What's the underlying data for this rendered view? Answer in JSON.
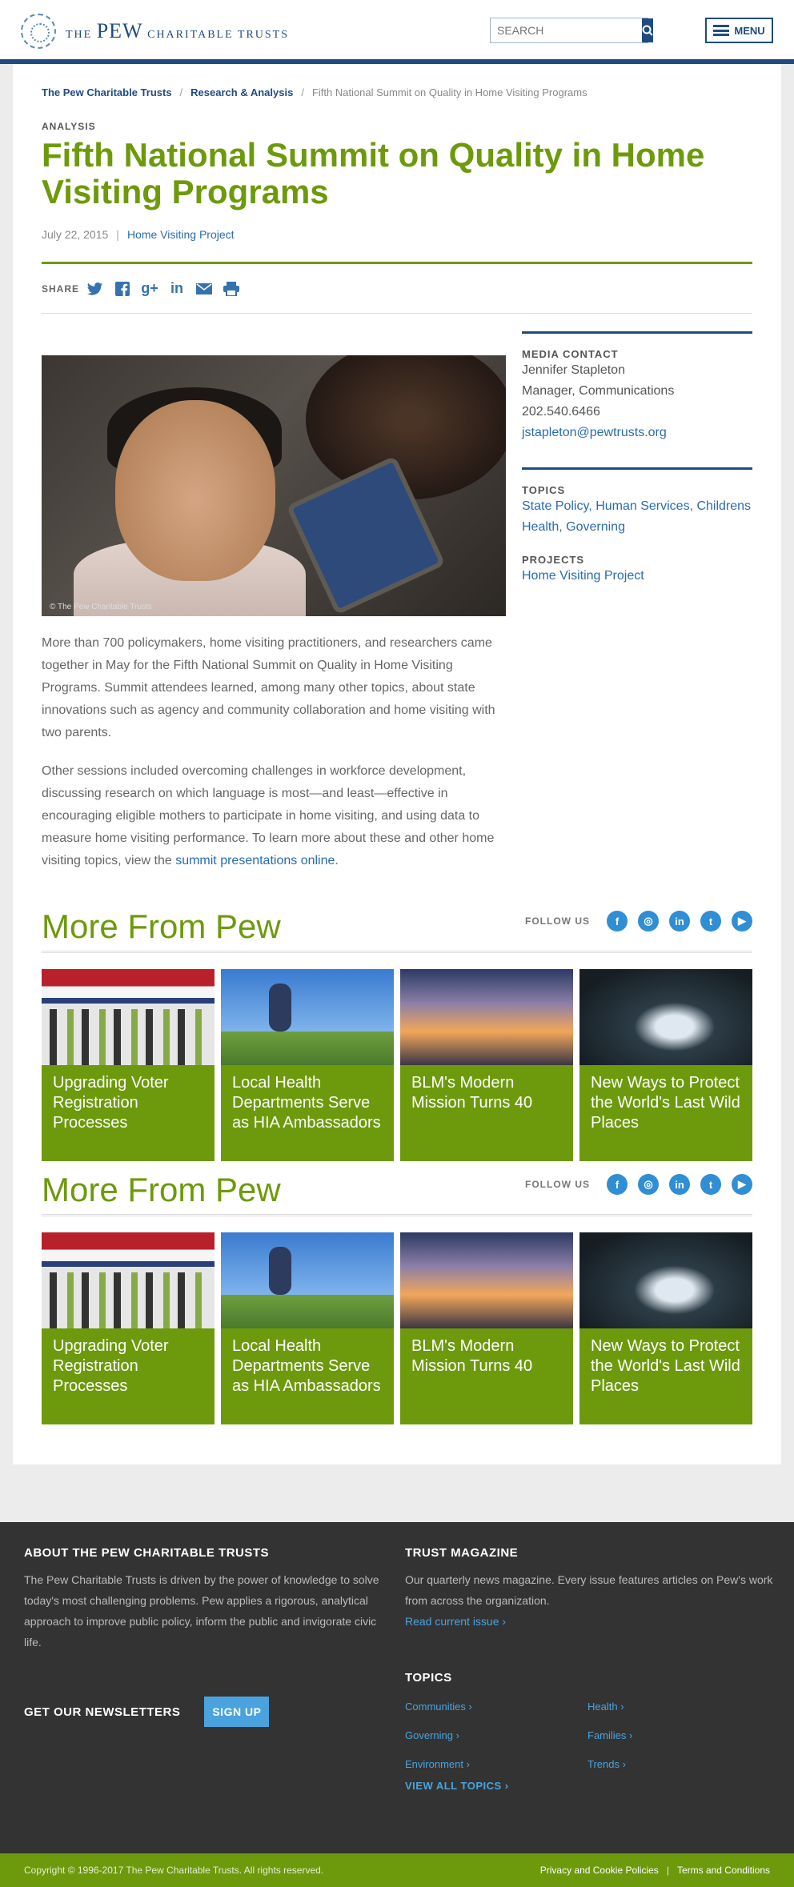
{
  "header": {
    "logo_small": "THE",
    "logo_big": "PEW",
    "logo_rest": "CHARITABLE TRUSTS",
    "search_placeholder": "SEARCH",
    "menu_label": "MENU"
  },
  "breadcrumb": [
    "The Pew Charitable Trusts",
    "Research & Analysis",
    "Fifth National Summit on Quality in Home Visiting Programs"
  ],
  "article": {
    "kicker": "ANALYSIS",
    "title": "Fifth National Summit on Quality in Home Visiting Programs",
    "date": "July 22, 2015",
    "project": "Home Visiting Project",
    "share_label": "SHARE",
    "share_icons": [
      "twitter-icon",
      "facebook-icon",
      "google-plus-icon",
      "linkedin-icon",
      "email-icon",
      "print-icon"
    ],
    "image_credit": "© The Pew Charitable Trusts",
    "p1": "More than 700 policymakers, home visiting practitioners, and researchers came together in May for the Fifth National Summit on Quality in Home Visiting Programs. Summit attendees learned, among many other topics, about state innovations such as agency and community collaboration and home visiting with two parents.",
    "p2_pre": "Other sessions included overcoming challenges in workforce development, discussing research on which language is most—and least—effective in encouraging eligible mothers to participate in home visiting, and using data to measure home visiting performance. To learn more about these and other home visiting topics, view the ",
    "p2_link": "summit presentations online",
    "p2_post": "."
  },
  "sidebar": {
    "contact_title": "MEDIA CONTACT",
    "contact_name": "Jennifer Stapleton",
    "contact_role": "Manager, Communications",
    "contact_phone": "202.540.6466",
    "contact_email": "jstapleton@pewtrusts.org",
    "topics_title": "TOPICS",
    "topics": "State Policy, Human Services, Childrens Health, Governing",
    "projects_title": "PROJECTS",
    "project": "Home Visiting Project"
  },
  "more": {
    "title": "More From Pew",
    "follow_label": "FOLLOW US",
    "social": [
      "f",
      "◎",
      "in",
      "t",
      "▶"
    ],
    "cards": [
      {
        "title": "Upgrading Voter Registration Processes"
      },
      {
        "title": "Local Health Departments Serve as HIA Ambassadors"
      },
      {
        "title": "BLM's Modern Mission Turns 40"
      },
      {
        "title": "New Ways to Protect the World's Last Wild Places"
      }
    ]
  },
  "footer": {
    "about_title": "ABOUT THE PEW CHARITABLE TRUSTS",
    "about_text": "The Pew Charitable Trusts is driven by the power of knowledge to solve today's most challenging problems. Pew applies a rigorous, analytical approach to improve public policy, inform the public and invigorate civic life.",
    "magazine_title": "TRUST MAGAZINE",
    "magazine_text": "Our quarterly news magazine. Every issue features articles on Pew's work from across the organization.",
    "magazine_link": "Read current issue ›",
    "newsletter_title": "GET OUR NEWSLETTERS",
    "signup": "SIGN UP",
    "topics_title": "TOPICS",
    "topics": [
      "Communities ›",
      "Health ›",
      "Governing ›",
      "Families ›",
      "Environment ›",
      "Trends ›"
    ],
    "view_all": "VIEW ALL TOPICS ›",
    "copyright": "Copyright © 1996-2017 The Pew Charitable Trusts. All rights reserved.",
    "privacy": "Privacy and Cookie Policies",
    "terms": "Terms and Conditions"
  }
}
